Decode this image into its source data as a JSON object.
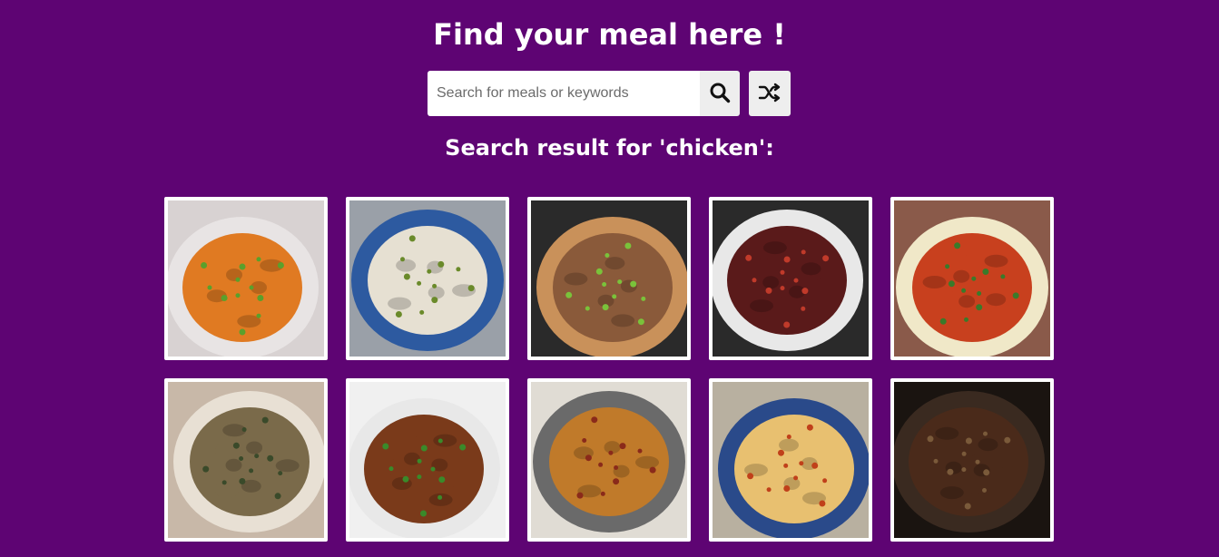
{
  "header": {
    "title": "Find your meal here !"
  },
  "search": {
    "placeholder": "Search for meals or keywords",
    "value": "",
    "search_icon": "search-icon",
    "random_icon": "shuffle-icon"
  },
  "results": {
    "heading": "Search result for 'chicken':"
  },
  "meals": [
    {
      "image": "chicken curry in floral bowl",
      "plate": "#e8e4e4",
      "food": "#e07a22",
      "accent": "#5aa02c",
      "bg": "#d8d2d2"
    },
    {
      "image": "chicken congee in blue patterned bowl",
      "plate": "#2d5aa0",
      "food": "#e6e0d2",
      "accent": "#6a8a2a",
      "bg": "#9aa0a8"
    },
    {
      "image": "grilled chicken on lettuce on board",
      "plate": "#c9915a",
      "food": "#8a5a3a",
      "accent": "#7ac23a",
      "bg": "#2a2a2a"
    },
    {
      "image": "chicken stew in white pot",
      "plate": "#e8e8e8",
      "food": "#5a1a1a",
      "accent": "#c03a2a",
      "bg": "#2a2a2a"
    },
    {
      "image": "tandoori chicken on plate",
      "plate": "#f0e8c8",
      "food": "#c8401e",
      "accent": "#3a7a2a",
      "bg": "#8a5a4a"
    },
    {
      "image": "chicken with beans in bowl",
      "plate": "#e8e0d4",
      "food": "#7a6a4a",
      "accent": "#3a4a2a",
      "bg": "#c8b8a8"
    },
    {
      "image": "chicken stir fry with vegetables",
      "plate": "#e8e8e8",
      "food": "#7a3a1a",
      "accent": "#3a8a2a",
      "bg": "#f0f0f0"
    },
    {
      "image": "chicken casserole in pan",
      "plate": "#6a6a6a",
      "food": "#c07a2a",
      "accent": "#8a2a1a",
      "bg": "#e0dcd4"
    },
    {
      "image": "chicken pie in blue dish",
      "plate": "#2a4a8a",
      "food": "#e8c070",
      "accent": "#c0401a",
      "bg": "#b8b0a0"
    },
    {
      "image": "chicken adobo in bowl",
      "plate": "#3a2a20",
      "food": "#4a2a1a",
      "accent": "#7a5a3a",
      "bg": "#1a1410"
    }
  ]
}
